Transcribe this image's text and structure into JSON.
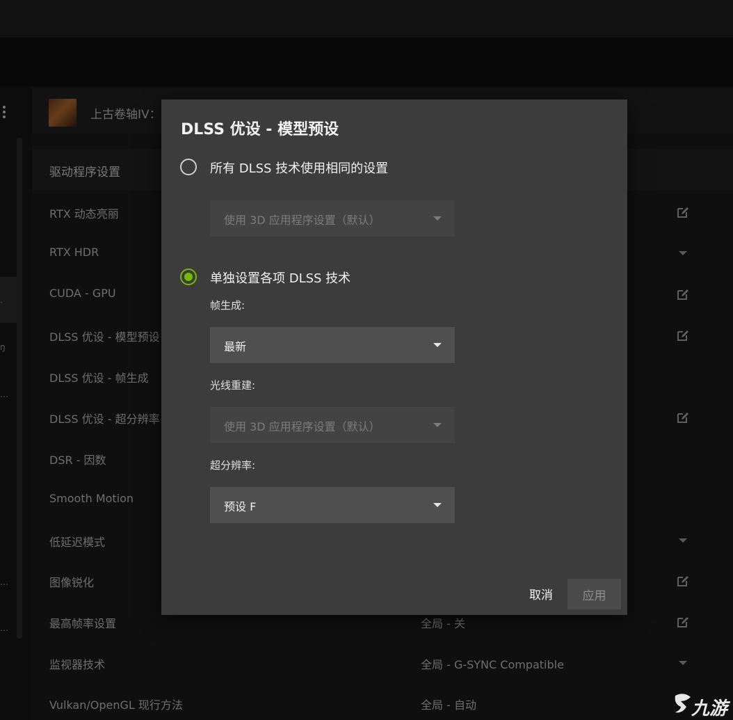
{
  "game": {
    "name": "上古卷轴IV："
  },
  "section": {
    "title": "驱动程序设置"
  },
  "settings": [
    {
      "label": "RTX 动态亮丽",
      "value": "",
      "control": "edit-icon"
    },
    {
      "label": "RTX HDR",
      "value": "",
      "control": "dropdown-arrow-icon"
    },
    {
      "label": "CUDA - GPU",
      "value": "",
      "control": "edit-icon"
    },
    {
      "label": "DLSS 优设 - 模型预设",
      "value": "",
      "control": "edit-icon"
    },
    {
      "label": "DLSS 优设 - 帧生成",
      "value": "",
      "control": ""
    },
    {
      "label": "DLSS 优设 - 超分辨率",
      "value": "",
      "control": "edit-icon"
    },
    {
      "label": "DSR - 因数",
      "value": "",
      "control": ""
    },
    {
      "label": "Smooth Motion",
      "value": "",
      "control": ""
    },
    {
      "label": "低延迟模式",
      "value": "",
      "control": "dropdown-arrow-icon"
    },
    {
      "label": "图像锐化",
      "value": "",
      "control": "edit-icon"
    },
    {
      "label": "最高帧率设置",
      "value": "全局 - 关",
      "control": "edit-icon"
    },
    {
      "label": "监视器技术",
      "value": "全局 - G-SYNC Compatible",
      "control": "dropdown-arrow-icon"
    },
    {
      "label": "Vulkan/OpenGL 现行方法",
      "value": "全局 - 自动",
      "control": ""
    }
  ],
  "dialog": {
    "title": "DLSS 优设 - 模型预设",
    "option_all": {
      "label": "所有 DLSS 技术使用相同的设置",
      "selected": false
    },
    "option_all_select": {
      "value": "使用 3D 应用程序设置（默认）",
      "disabled": true
    },
    "option_each": {
      "label": "单独设置各项 DLSS 技术",
      "selected": true
    },
    "frame_gen": {
      "label": "帧生成:",
      "value": "最新",
      "disabled": false
    },
    "ray_recon": {
      "label": "光线重建:",
      "value": "使用 3D 应用程序设置（默认）",
      "disabled": true
    },
    "super_res": {
      "label": "超分辨率:",
      "value": "预设 F",
      "disabled": false
    },
    "cancel_label": "取消",
    "apply_label": "应用"
  },
  "colors": {
    "accent": "#76b900",
    "dialog_bg": "#3c3c3c",
    "page_bg": "#161616"
  },
  "watermark": {
    "text": "九游"
  }
}
